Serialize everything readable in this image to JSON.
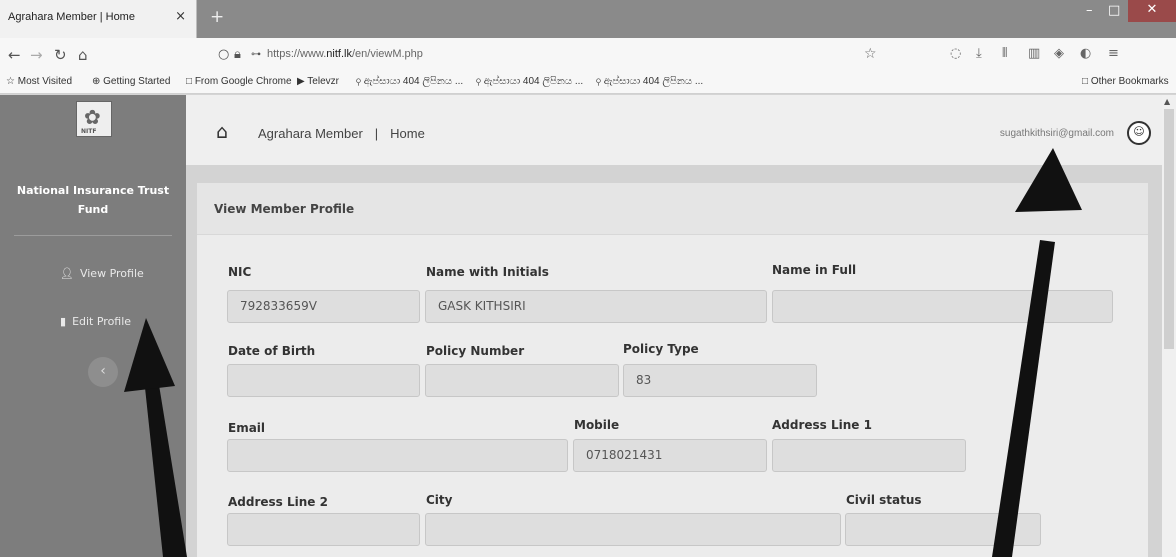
{
  "browser": {
    "tab_title": "Agrahara Member | Home",
    "tab_close": "×",
    "new_tab": "+",
    "url_prefix": "https://www.",
    "url_domain": "nitf.lk",
    "url_path": "/en/viewM.php",
    "bookmarks": [
      "☆ Most Visited",
      "⊕ Getting Started",
      "□ From Google Chrome",
      "▶ Televzr",
      "⚲ ඇප්සායා 404 ලිපිනය ...",
      "⚲ ඇප්සායා 404 ලිපිනය ...",
      "⚲ ඇප්සායා 404 ලිපිනය ..."
    ],
    "other_bookmarks": "□ Other Bookmarks"
  },
  "sidebar": {
    "org_line1": "National Insurance Trust",
    "org_line2": "Fund",
    "items": [
      {
        "label": "View Profile",
        "icon": "user-icon"
      },
      {
        "label": "Edit Profile",
        "icon": "document-icon"
      }
    ]
  },
  "header": {
    "breadcrumb_app": "Agrahara Member",
    "breadcrumb_sep": "|",
    "breadcrumb_page": "Home",
    "user_email": "sugathkithsiri@gmail.com"
  },
  "profile": {
    "title": "View Member Profile",
    "labels": {
      "nic": "NIC",
      "name_initials": "Name with Initials",
      "name_full": "Name in Full",
      "dob": "Date of Birth",
      "policy_number": "Policy Number",
      "policy_type": "Policy Type",
      "email": "Email",
      "mobile": "Mobile",
      "address1": "Address Line 1",
      "address2": "Address Line 2",
      "city": "City",
      "civil_status": "Civil status"
    },
    "values": {
      "nic": "792833659V",
      "name_initials": "GASK KITHSIRI",
      "name_full": "",
      "dob": "",
      "policy_number": "",
      "policy_type": "83",
      "email": "",
      "mobile": "0718021431",
      "address1": "",
      "address2": "",
      "city": "",
      "civil_status": ""
    }
  },
  "colors": {
    "sidebar_bg": "#7d7d7d",
    "arrow": "#111111"
  }
}
